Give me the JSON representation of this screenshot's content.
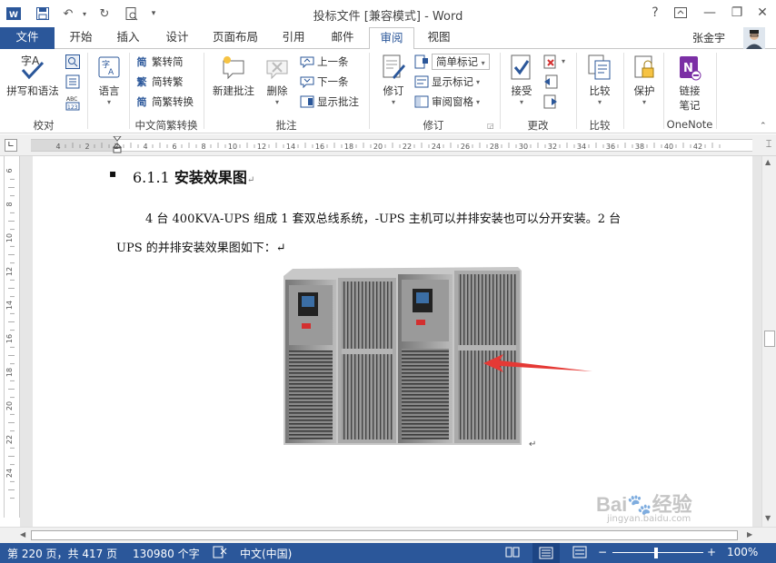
{
  "window": {
    "title": "投标文件 [兼容模式] - Word",
    "help": "?",
    "minimize": "—",
    "restore": "❐",
    "close": "✕"
  },
  "tabs": [
    {
      "label": "文件"
    },
    {
      "label": "开始"
    },
    {
      "label": "插入"
    },
    {
      "label": "设计"
    },
    {
      "label": "页面布局"
    },
    {
      "label": "引用"
    },
    {
      "label": "邮件"
    },
    {
      "label": "审阅"
    },
    {
      "label": "视图"
    }
  ],
  "user": {
    "name": "张金宇"
  },
  "ribbon": {
    "proofing": {
      "spelling": "拼写和语法",
      "label": "校对"
    },
    "language": {
      "language": "语言"
    },
    "chinese": {
      "to_simplified": "繁转简",
      "to_traditional": "简转繁",
      "convert": "简繁转换",
      "label": "中文简繁转换"
    },
    "comments": {
      "new": "新建批注",
      "delete": "删除",
      "previous": "上一条",
      "next": "下一条",
      "show": "显示批注",
      "label": "批注"
    },
    "tracking": {
      "track": "修订",
      "simple_markup": "简单标记",
      "show_markup": "显示标记",
      "reviewing_pane": "审阅窗格",
      "label": "修订"
    },
    "changes": {
      "accept": "接受",
      "label": "更改"
    },
    "compare": {
      "compare": "比较",
      "label": "比较"
    },
    "protect": {
      "protect": "保护"
    },
    "onenote": {
      "linked_notes_1": "链接",
      "linked_notes_2": "笔记",
      "label": "OneNote"
    }
  },
  "ruler": {
    "h_ticks": [
      "4",
      "2",
      "2",
      "4",
      "6",
      "8",
      "10",
      "12",
      "14",
      "16",
      "18",
      "20",
      "22",
      "24",
      "26",
      "28",
      "30",
      "32",
      "34",
      "36",
      "38",
      "40",
      "42"
    ],
    "v_ticks": [
      "6",
      "8",
      "10",
      "12",
      "14",
      "16",
      "18",
      "20",
      "22",
      "24"
    ]
  },
  "document": {
    "bullet": "▪",
    "heading_number": "6.1.1",
    "heading_text": "安装效果图",
    "para_mark": "↵",
    "line1": "4 台 400KVA-UPS 组成 1 套双总线系统，-UPS 主机可以并排安装也可以分开安装。2 台",
    "line2": "UPS 的并排安装效果图如下：↵"
  },
  "watermark": {
    "brand": "Bai",
    "brand2": "经验",
    "url": "jingyan.baidu.com"
  },
  "status": {
    "page": "第 220 页，共 417 页",
    "words": "130980 个字",
    "language": "中文(中国)",
    "zoom": "100%"
  },
  "colors": {
    "accent": "#2b579a",
    "arrow": "#e53935"
  }
}
